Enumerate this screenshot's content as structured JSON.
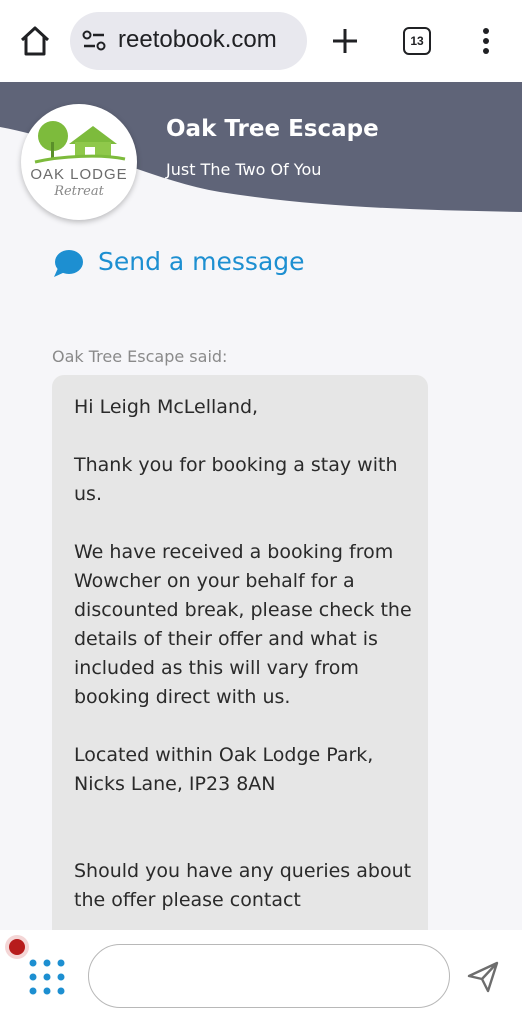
{
  "browser": {
    "url": "reetobook.com",
    "tab_count": "13"
  },
  "header": {
    "business_name": "Oak Tree Escape",
    "tagline": "Just The Two Of You",
    "logo_word": "OAK LODGE",
    "logo_script": "Retreat"
  },
  "send_message": {
    "label": "Send a message"
  },
  "message": {
    "sender": "Oak Tree Escape said:",
    "greeting": "Hi Leigh McLelland,",
    "para1": "Thank you for booking a stay with us.",
    "para2": "We have received a booking from Wowcher on your behalf for a discounted break, please check the details of their offer and what is included as this will vary from booking direct with us.",
    "para3": "Located within Oak Lodge Park, Nicks Lane, IP23 8AN",
    "para4": "Should you have any queries about the offer please contact"
  },
  "composer": {
    "input_value": "",
    "placeholder": ""
  },
  "colors": {
    "header_bg": "#5f6478",
    "accent_blue": "#1d8fd1",
    "bubble_bg": "#e6e6e6",
    "logo_green": "#7dbb3c"
  }
}
